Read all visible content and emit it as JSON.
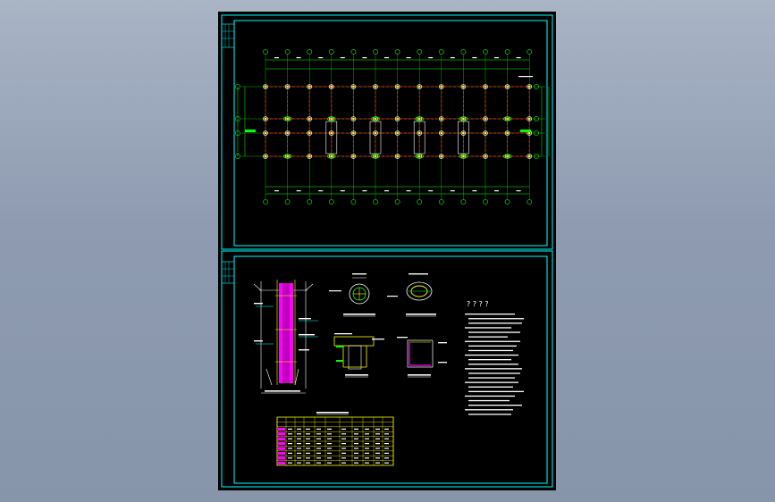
{
  "viewer": {
    "background_top": "#a9b4c5",
    "background_bottom": "#8795ab"
  },
  "drawing": {
    "sheet_color": "#000000",
    "frame_color": "#00ffff",
    "axis_color": "#00ff00",
    "grid_color": "#ff2020",
    "column_color": "#ffffff",
    "pile_color": "#ff00ff",
    "text_color": "#ffffff",
    "yellow_color": "#ffff00",
    "notes_heading": "? ? ? ?"
  },
  "icons": {
    "title_block": "title-block-icon"
  }
}
